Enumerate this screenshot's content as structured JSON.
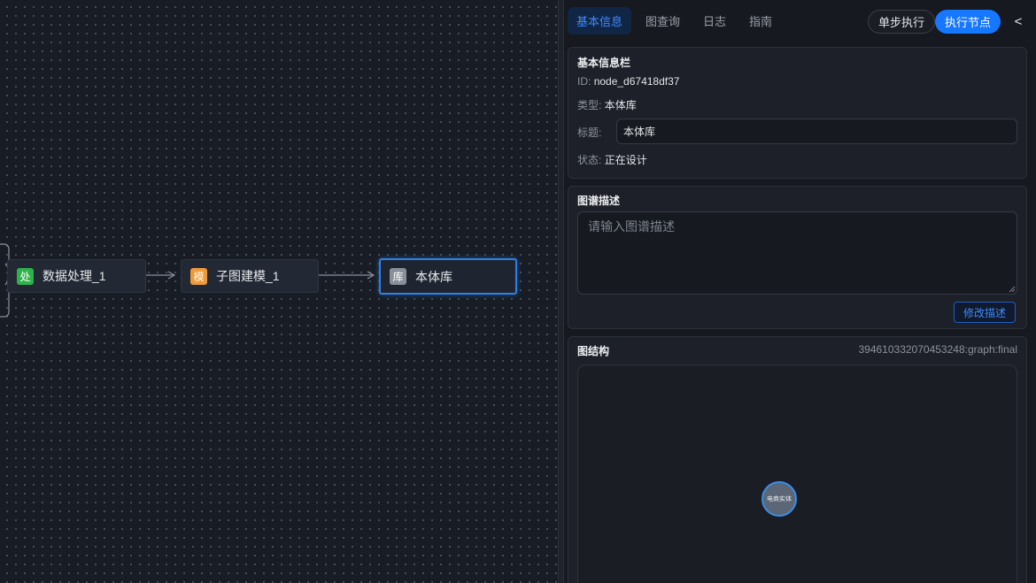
{
  "canvas": {
    "nodes": [
      {
        "badge": "处",
        "badge_color": "#2eb24a",
        "label": "数据处理_1"
      },
      {
        "badge": "模",
        "badge_color": "#ee9a3a",
        "label": "子图建模_1"
      },
      {
        "badge": "库",
        "badge_color": "#8a8f99",
        "label": "本体库",
        "selected": true
      }
    ],
    "selected_color": "#2f7fe6"
  },
  "panel": {
    "tabs": [
      "基本信息",
      "图查询",
      "日志",
      "指南"
    ],
    "active_tab": "基本信息",
    "step_button": "单步执行",
    "exec_button": "执行节点",
    "collapse_button": "<",
    "basic_info": {
      "title": "基本信息栏",
      "id_label": "ID:",
      "id_value": "node_d67418df37",
      "type_label": "类型:",
      "type_value": "本体库",
      "name_label": "标题:",
      "name_value": "本体库",
      "status_label": "状态:",
      "status_value": "正在设计"
    },
    "description": {
      "title": "图谱描述",
      "placeholder": "请输入图谱描述",
      "value": "",
      "button": "修改描述"
    },
    "structure": {
      "title": "图结构",
      "graph_id": "394610332070453248:graph:final",
      "nodes": [
        {
          "label": "电商实体"
        }
      ]
    }
  },
  "colors": {
    "accent": "#1677ff",
    "panel_bg": "#16191f",
    "card_bg": "#1d2028"
  }
}
